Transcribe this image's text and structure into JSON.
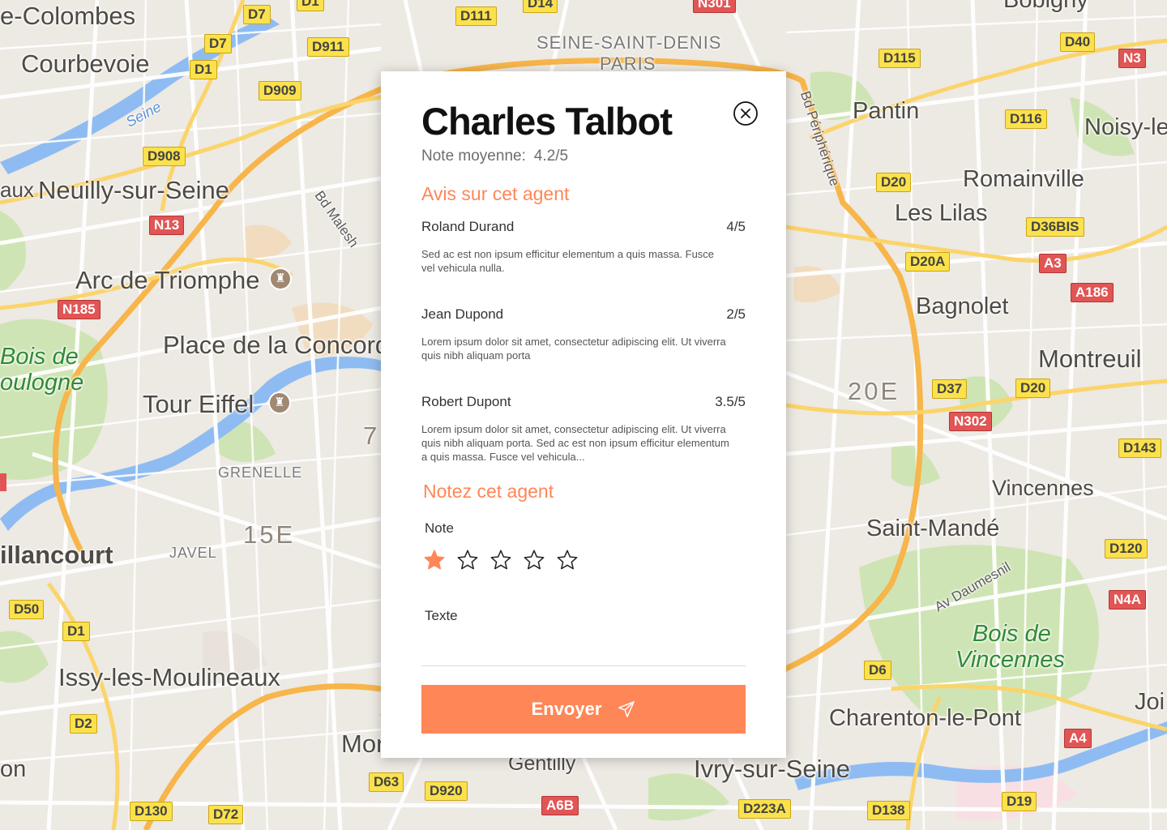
{
  "map": {
    "places": [
      {
        "name": "e-Colombes"
      },
      {
        "name": "Courbevoie"
      },
      {
        "name": "Neuilly-sur-Seine"
      },
      {
        "name": "aux"
      },
      {
        "name": "Arc de Triomphe"
      },
      {
        "name": "Place de la Concord"
      },
      {
        "name": "Tour Eiffel"
      },
      {
        "name": "illancourt"
      },
      {
        "name": "Issy-les-Moulineaux"
      },
      {
        "name": "Mor"
      },
      {
        "name": "Gentilly"
      },
      {
        "name": "Ivry-sur-Seine"
      },
      {
        "name": "Charenton-le-Pont"
      },
      {
        "name": "Saint-Mandé"
      },
      {
        "name": "Vincennes"
      },
      {
        "name": "Montreuil"
      },
      {
        "name": "Bagnolet"
      },
      {
        "name": "Les Lilas"
      },
      {
        "name": "Romainville"
      },
      {
        "name": "Pantin"
      },
      {
        "name": "Noisy-le"
      },
      {
        "name": "Bobigny"
      },
      {
        "name": "Joi"
      },
      {
        "name": "on"
      },
      {
        "name": "7"
      }
    ],
    "districts": [
      "SEINE-SAINT-DENIS",
      "PARIS",
      "GRENELLE",
      "JAVEL",
      "15E",
      "20E"
    ],
    "parks": [
      "Bois de",
      "oulogne",
      "Bois de",
      "Vincennes"
    ],
    "streets": [
      "Bd Malesh",
      "Bd Périphérique",
      "Av Daumesnil"
    ],
    "water": [
      "Seine"
    ],
    "shields": [
      "D7",
      "D1",
      "D7",
      "D1",
      "D911",
      "D909",
      "D908",
      "D111",
      "D14",
      "N301",
      "N13",
      "N185",
      "D115",
      "D40",
      "N3",
      "D116",
      "D20",
      "D36BIS",
      "D20A",
      "A3",
      "A186",
      "D37",
      "D20",
      "N302",
      "D143",
      "D120",
      "N4A",
      "D6",
      "A4",
      "D19",
      "D138",
      "D223A",
      "A6B",
      "D920",
      "D63",
      "D72",
      "D130",
      "D2",
      "D1",
      "D50"
    ]
  },
  "modal": {
    "agent_name": "Charles Talbot",
    "avg_label": "Note moyenne:",
    "avg_value": "4.2/5",
    "reviews_title": "Avis sur cet agent",
    "reviews": [
      {
        "author": "Roland Durand",
        "score": "4/5",
        "text": "Sed ac est non ipsum efficitur elementum a quis massa. Fusce vel vehicula nulla."
      },
      {
        "author": "Jean Dupond",
        "score": "2/5",
        "text": "Lorem ipsum dolor sit amet, consectetur adipiscing elit. Ut viverra quis nibh aliquam porta"
      },
      {
        "author": "Robert Dupont",
        "score": "3.5/5",
        "text": "Lorem ipsum dolor sit amet, consectetur adipiscing elit. Ut viverra quis nibh aliquam porta. Sed ac est non ipsum efficitur elementum a quis massa. Fusce vel vehicula..."
      }
    ],
    "rate_title": "Notez cet agent",
    "note_label": "Note",
    "rating": {
      "selected": 1,
      "max": 5
    },
    "text_label": "Texte",
    "text_value": "",
    "submit_label": "Envoyer",
    "colors": {
      "accent": "#ff8657",
      "star_filled": "#ff8657",
      "star_empty": "#222222"
    }
  }
}
